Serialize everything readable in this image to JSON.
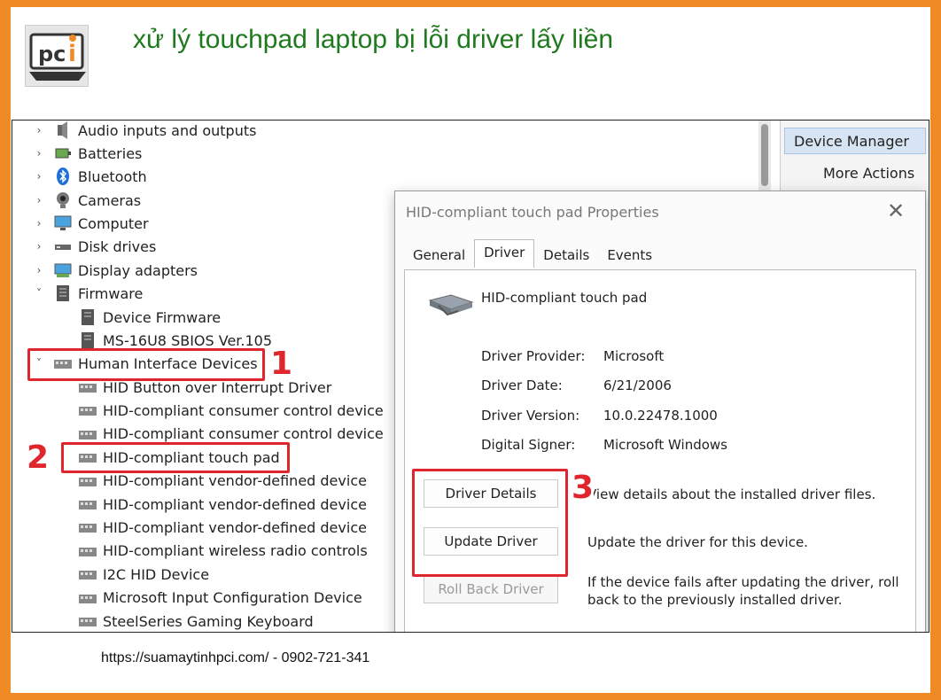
{
  "header": {
    "title": "xử lý touchpad laptop bị lỗi driver lấy liền"
  },
  "footer": {
    "text": "https://suamaytinhpci.com/ - 0902-721-341"
  },
  "tree": {
    "categories": [
      {
        "label": "Audio inputs and outputs",
        "icon": "speaker-icon",
        "expanded": false
      },
      {
        "label": "Batteries",
        "icon": "battery-icon",
        "expanded": false
      },
      {
        "label": "Bluetooth",
        "icon": "bluetooth-icon",
        "expanded": false
      },
      {
        "label": "Cameras",
        "icon": "camera-icon",
        "expanded": false
      },
      {
        "label": "Computer",
        "icon": "monitor-icon",
        "expanded": false
      },
      {
        "label": "Disk drives",
        "icon": "disk-icon",
        "expanded": false
      },
      {
        "label": "Display adapters",
        "icon": "display-adapter-icon",
        "expanded": false
      },
      {
        "label": "Firmware",
        "icon": "firmware-icon",
        "expanded": true
      }
    ],
    "firmware_children": [
      "Device Firmware",
      "MS-16U8 SBIOS Ver.105"
    ],
    "hid_category": "Human Interface Devices",
    "hid_children": [
      "HID Button over Interrupt Driver",
      "HID-compliant consumer control device",
      "HID-compliant consumer control device",
      "HID-compliant touch pad",
      "HID-compliant vendor-defined device",
      "HID-compliant vendor-defined device",
      "HID-compliant vendor-defined device",
      "HID-compliant wireless radio controls",
      "I2C HID Device",
      "Microsoft Input Configuration Device",
      "SteelSeries Gaming Keyboard"
    ]
  },
  "annotations": {
    "step1": "1",
    "step2": "2",
    "step3": "3",
    "color": "#e0262d"
  },
  "actions": {
    "header": "Device Manager",
    "more": "More Actions"
  },
  "dialog": {
    "title": "HID-compliant touch pad Properties",
    "close": "✕",
    "tabs": [
      "General",
      "Driver",
      "Details",
      "Events"
    ],
    "active_tab": "Driver",
    "device_name": "HID-compliant touch pad",
    "fields": [
      {
        "label": "Driver Provider:",
        "value": "Microsoft"
      },
      {
        "label": "Driver Date:",
        "value": "6/21/2006"
      },
      {
        "label": "Driver Version:",
        "value": "10.0.22478.1000"
      },
      {
        "label": "Digital Signer:",
        "value": "Microsoft Windows"
      }
    ],
    "buttons": {
      "details": "Driver Details",
      "details_desc": "View details about the installed driver files.",
      "update": "Update Driver",
      "update_desc": "Update the driver for this device.",
      "rollback": "Roll Back Driver",
      "rollback_desc_1": "If the device fails after updating the driver, roll",
      "rollback_desc_2": "back to the previously installed driver."
    }
  }
}
